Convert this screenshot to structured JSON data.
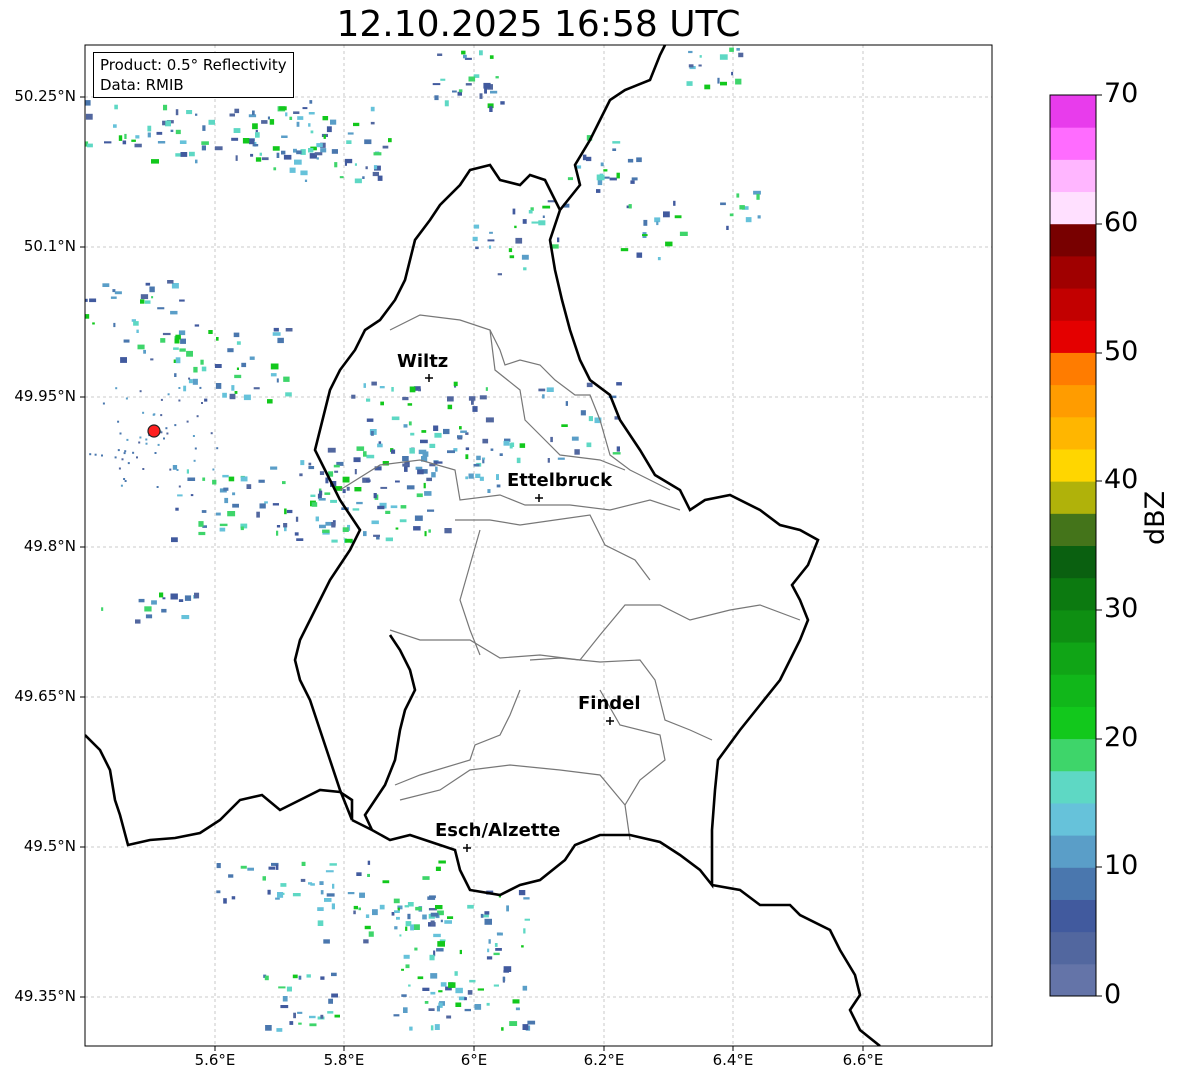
{
  "title": "12.10.2025 16:58 UTC",
  "info": {
    "product": "Product: 0.5° Reflectivity",
    "data": "Data: RMIB"
  },
  "map": {
    "lon_range": [
      5.4,
      6.8
    ],
    "lat_range": [
      49.3,
      50.3
    ],
    "lat_ticks": [
      "50.25°N",
      "50.1°N",
      "49.95°N",
      "49.8°N",
      "49.65°N",
      "49.5°N",
      "49.35°N"
    ],
    "lon_ticks": [
      "5.6°E",
      "5.8°E",
      "6°E",
      "6.2°E",
      "6.4°E",
      "6.6°E"
    ],
    "radar_site_color": "#ff2020",
    "cities": [
      {
        "name": "Wiltz",
        "lon": 5.93,
        "lat": 49.966
      },
      {
        "name": "Ettelbruck",
        "lon": 6.1,
        "lat": 49.847
      },
      {
        "name": "Findel",
        "lon": 6.21,
        "lat": 49.626
      },
      {
        "name": "Esch/Alzette",
        "lon": 5.99,
        "lat": 49.5
      }
    ]
  },
  "colorbar": {
    "label": "dBZ",
    "ticks": [
      "0",
      "10",
      "20",
      "30",
      "40",
      "50",
      "60",
      "70"
    ],
    "colors": [
      "#6474a8",
      "#52679f",
      "#415a9e",
      "#4a77ae",
      "#5a9ec8",
      "#66c2da",
      "#5ed8c4",
      "#3ed56a",
      "#12c81c",
      "#11b71a",
      "#10a516",
      "#0e8f12",
      "#0c7a10",
      "#0a6010",
      "#44741a",
      "#b0b20a",
      "#ffd600",
      "#ffb600",
      "#ff9c00",
      "#ff7c00",
      "#e40000",
      "#c20000",
      "#a00000",
      "#780000",
      "#ffe0ff",
      "#ffb6ff",
      "#ff6cff",
      "#e83cec"
    ]
  }
}
